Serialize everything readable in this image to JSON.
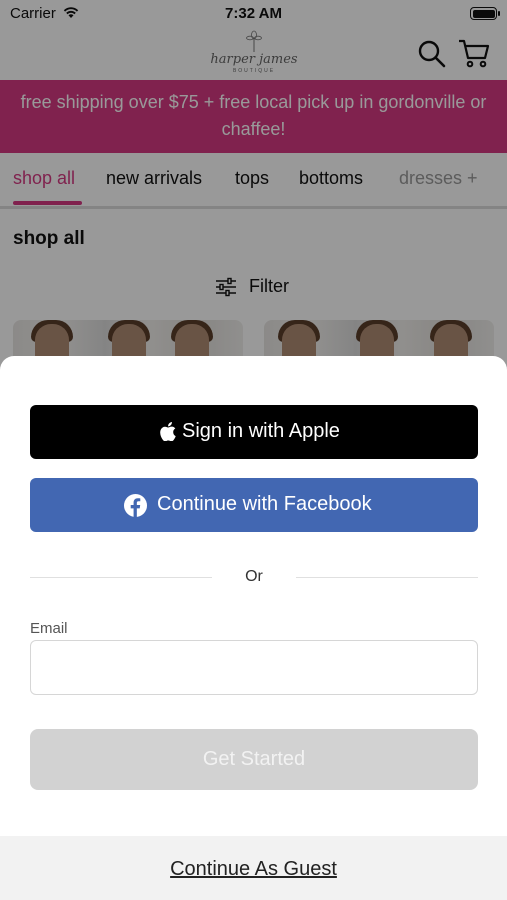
{
  "status_bar": {
    "carrier": "Carrier",
    "time": "7:32 AM"
  },
  "header": {
    "logo_script": "harper james",
    "logo_sub": "BOUTIQUE",
    "icons": [
      "search-icon",
      "cart-icon"
    ]
  },
  "promo": {
    "text": "free shipping over $75 + free local pick up in gordonville or chaffee!"
  },
  "tabs": [
    {
      "label": "shop all",
      "active": true
    },
    {
      "label": "new arrivals",
      "active": false
    },
    {
      "label": "tops",
      "active": false
    },
    {
      "label": "bottoms",
      "active": false
    },
    {
      "label": "dresses +",
      "active": false
    }
  ],
  "page": {
    "title": "shop all",
    "filter_label": "Filter"
  },
  "sheet": {
    "apple_button": "Sign in with Apple",
    "facebook_button": "Continue with Facebook",
    "or_text": "Or",
    "email_label": "Email",
    "email_value": "",
    "email_placeholder": "",
    "get_started_button": "Get Started",
    "guest_link": "Continue As Guest"
  },
  "colors": {
    "brand_pink": "#d63a83",
    "facebook_blue": "#4267b2",
    "apple_black": "#000000",
    "disabled_gray": "#d2d2d2"
  }
}
